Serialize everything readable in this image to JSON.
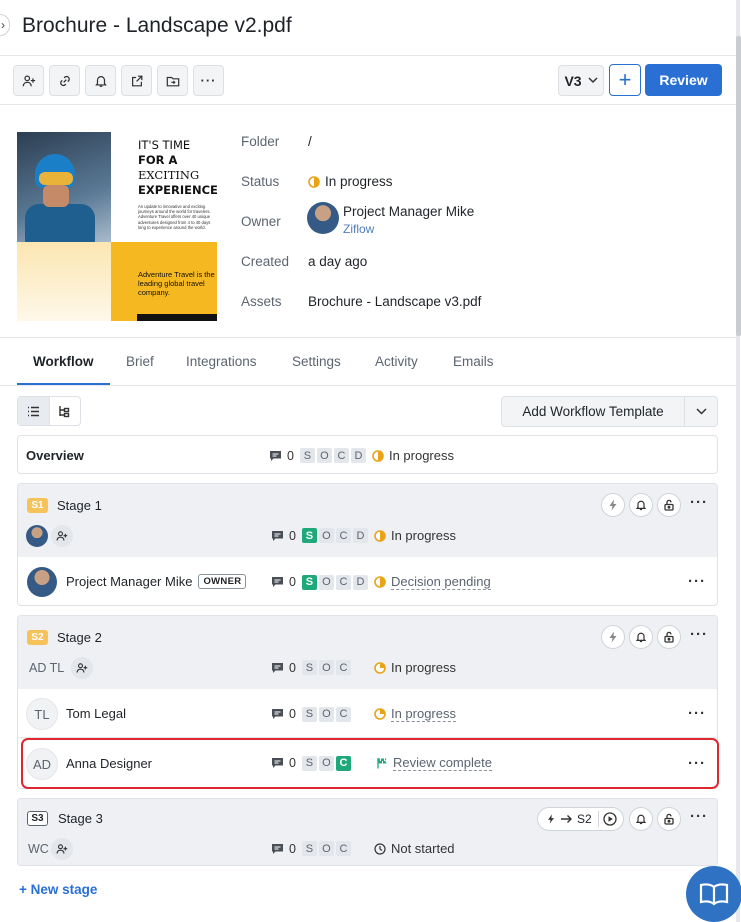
{
  "header": {
    "title": "Brochure - Landscape v2.pdf"
  },
  "toolbar": {
    "version": "V3",
    "review_label": "Review"
  },
  "thumbnail": {
    "headline_1": "IT'S TIME",
    "headline_2": "FOR A",
    "headline_3": "EXCITING",
    "headline_4": "EXPERIENCE",
    "body": "An update to innovative and exciting journeys around the world for travelers. Adventure Travel offers over 40 unique adventures designed from 4 to 40 days long to experience around the world.",
    "tagline": "Adventure Travel is the leading global travel company."
  },
  "meta": {
    "folder_label": "Folder",
    "folder_value": "/",
    "status_label": "Status",
    "status_value": "In progress",
    "owner_label": "Owner",
    "owner_name": "Project Manager Mike",
    "owner_org": "Ziflow",
    "created_label": "Created",
    "created_value": "a day ago",
    "assets_label": "Assets",
    "assets_value": "Brochure - Landscape v3.pdf"
  },
  "tabs": [
    "Workflow",
    "Brief",
    "Integrations",
    "Settings",
    "Activity",
    "Emails"
  ],
  "workflow": {
    "template_label": "Add Workflow Template",
    "overview": {
      "label": "Overview",
      "comments": "0",
      "letters": [
        "S",
        "O",
        "C",
        "D"
      ],
      "status": "In progress"
    },
    "stage1": {
      "badge": "S1",
      "name": "Stage 1",
      "summary": {
        "comments": "0",
        "letters": [
          "S",
          "O",
          "C",
          "D"
        ],
        "status": "In progress"
      },
      "members": [
        {
          "name": "Project Manager Mike",
          "tag": "OWNER",
          "comments": "0",
          "letters": [
            "S",
            "O",
            "C",
            "D"
          ],
          "status": "Decision pending"
        }
      ]
    },
    "stage2": {
      "badge": "S2",
      "name": "Stage 2",
      "initials": "AD TL",
      "summary": {
        "comments": "0",
        "letters": [
          "S",
          "O",
          "C"
        ],
        "status": "In progress"
      },
      "members": [
        {
          "initials": "TL",
          "name": "Tom Legal",
          "comments": "0",
          "letters": [
            "S",
            "O",
            "C"
          ],
          "status": "In progress"
        },
        {
          "initials": "AD",
          "name": "Anna Designer",
          "comments": "0",
          "letters": [
            "S",
            "O",
            "C"
          ],
          "status": "Review complete"
        }
      ]
    },
    "stage3": {
      "badge": "S3",
      "name": "Stage 3",
      "initials": "WC",
      "chain_target": "S2",
      "summary": {
        "comments": "0",
        "letters": [
          "S",
          "O",
          "C"
        ],
        "status": "Not started"
      }
    },
    "new_stage": "+ New stage"
  },
  "colors": {
    "accent": "#2a6fd4",
    "success": "#1fa97a",
    "stage_badge": "#f5c35a",
    "highlight": "#e0262f"
  }
}
